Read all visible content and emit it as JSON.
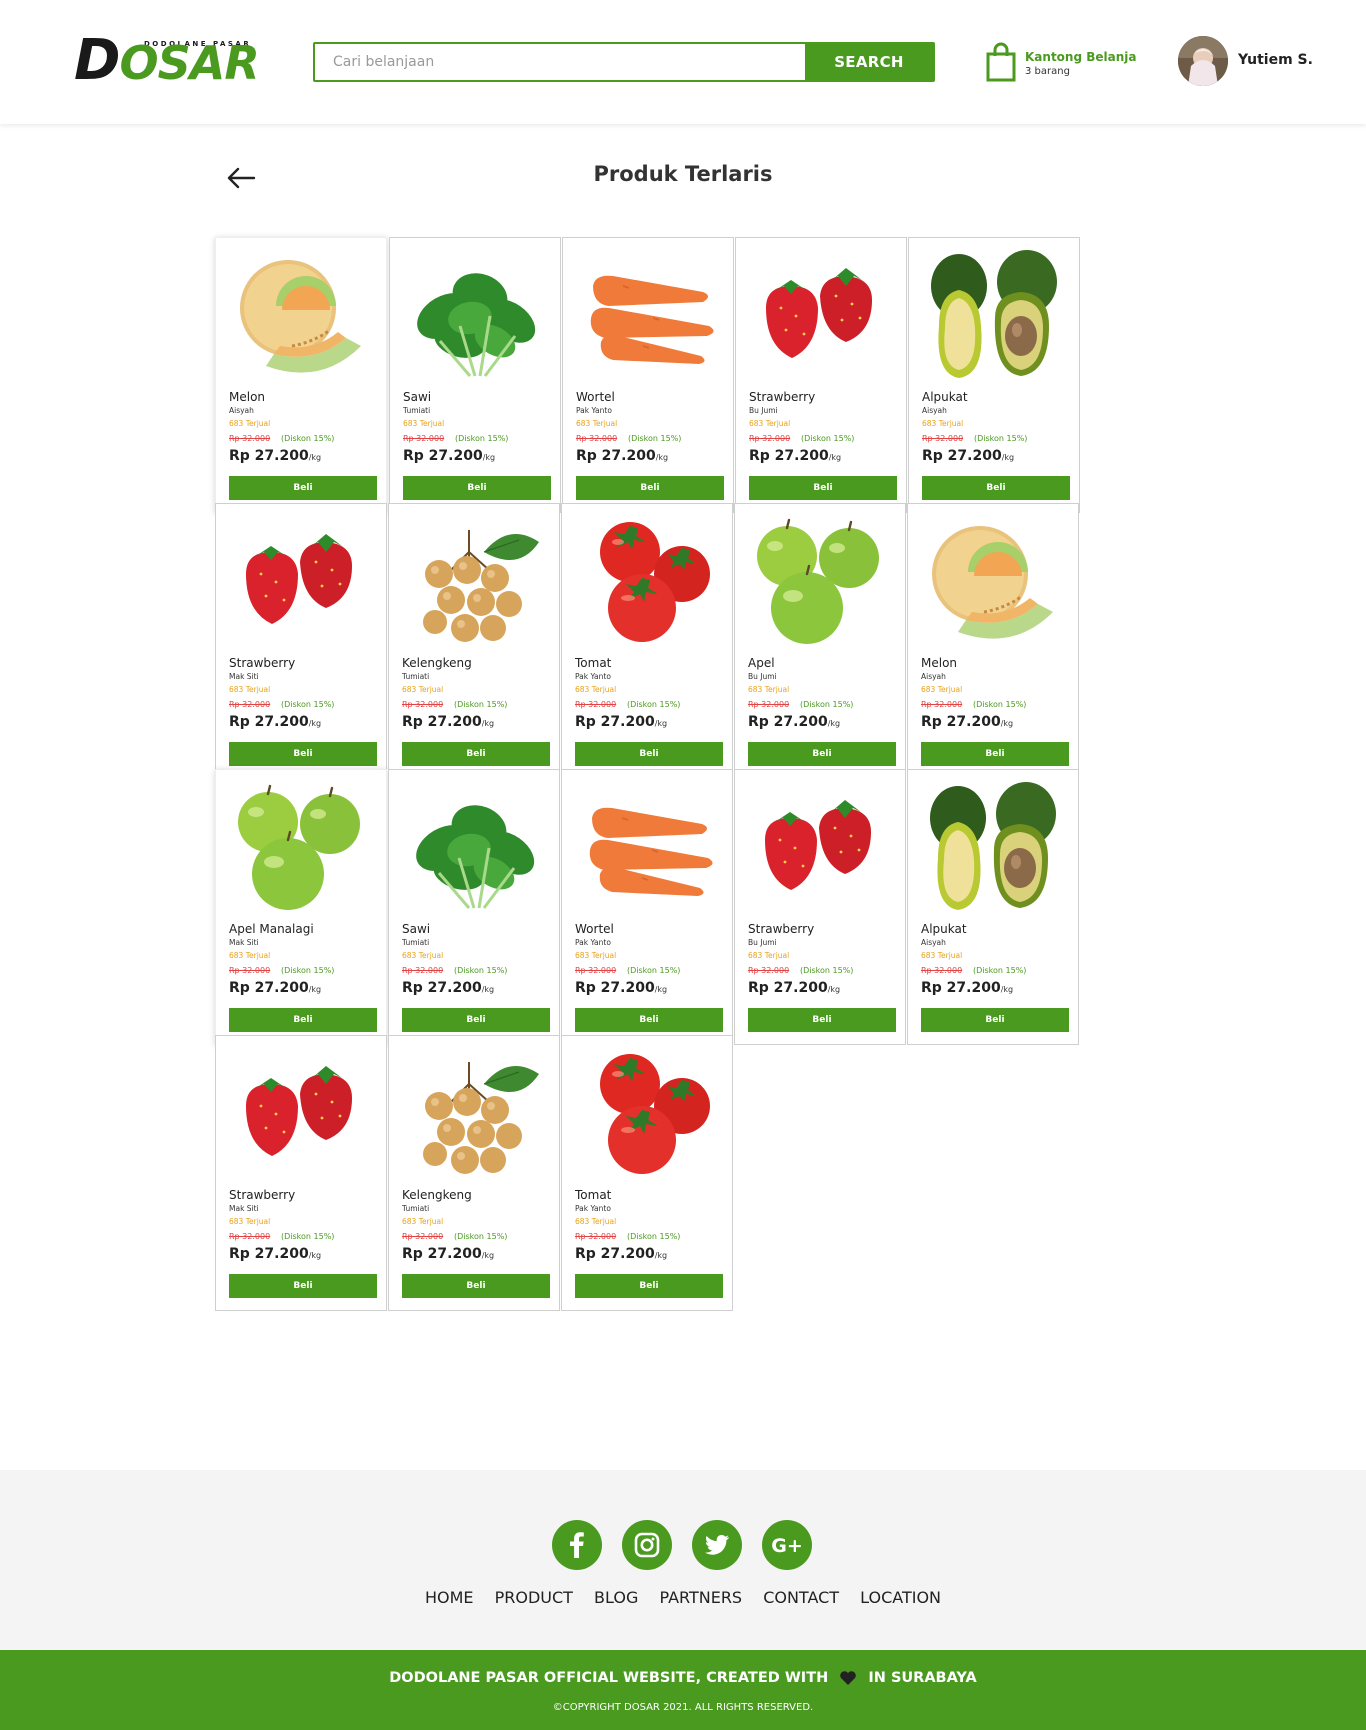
{
  "header": {
    "logo_tagline": "DODOLANE PASAR",
    "logo_d": "D",
    "logo_rest": "OSAR",
    "search_placeholder": "Cari belanjaan",
    "search_button": "SEARCH",
    "cart_title": "Kantong Belanja",
    "cart_count": "3 barang",
    "user_name": "Yutiem S."
  },
  "page": {
    "title": "Produk Terlaris"
  },
  "products": [
    {
      "name": "Melon",
      "seller": "Aisyah",
      "sold": "683 Terjual",
      "old_price": "Rp 32.000",
      "discount": "(Diskon 15%)",
      "price": "Rp 27.200",
      "unit": "/kg",
      "buy": "Beli",
      "image": "melon"
    },
    {
      "name": "Sawi",
      "seller": "Tumiati",
      "sold": "683 Terjual",
      "old_price": "Rp 32.000",
      "discount": "(Diskon 15%)",
      "price": "Rp 27.200",
      "unit": "/kg",
      "buy": "Beli",
      "image": "greens"
    },
    {
      "name": "Wortel",
      "seller": "Pak Yanto",
      "sold": "683 Terjual",
      "old_price": "Rp 32.000",
      "discount": "(Diskon 15%)",
      "price": "Rp 27.200",
      "unit": "/kg",
      "buy": "Beli",
      "image": "carrot"
    },
    {
      "name": "Strawberry",
      "seller": "Bu Jumi",
      "sold": "683 Terjual",
      "old_price": "Rp 32.000",
      "discount": "(Diskon 15%)",
      "price": "Rp 27.200",
      "unit": "/kg",
      "buy": "Beli",
      "image": "strawberry"
    },
    {
      "name": "Alpukat",
      "seller": "Aisyah",
      "sold": "683 Terjual",
      "old_price": "Rp 32.000",
      "discount": "(Diskon 15%)",
      "price": "Rp 27.200",
      "unit": "/kg",
      "buy": "Beli",
      "image": "avocado"
    },
    {
      "name": "Strawberry",
      "seller": "Mak Siti",
      "sold": "683 Terjual",
      "old_price": "Rp 32.000",
      "discount": "(Diskon 15%)",
      "price": "Rp 27.200",
      "unit": "/kg",
      "buy": "Beli",
      "image": "strawberry"
    },
    {
      "name": "Kelengkeng",
      "seller": "Tumiati",
      "sold": "683 Terjual",
      "old_price": "Rp 32.000",
      "discount": "(Diskon 15%)",
      "price": "Rp 27.200",
      "unit": "/kg",
      "buy": "Beli",
      "image": "longan"
    },
    {
      "name": "Tomat",
      "seller": "Pak Yanto",
      "sold": "683 Terjual",
      "old_price": "Rp 32.000",
      "discount": "(Diskon 15%)",
      "price": "Rp 27.200",
      "unit": "/kg",
      "buy": "Beli",
      "image": "tomato"
    },
    {
      "name": "Apel",
      "seller": "Bu Jumi",
      "sold": "683 Terjual",
      "old_price": "Rp 32.000",
      "discount": "(Diskon 15%)",
      "price": "Rp 27.200",
      "unit": "/kg",
      "buy": "Beli",
      "image": "apple"
    },
    {
      "name": "Melon",
      "seller": "Aisyah",
      "sold": "683 Terjual",
      "old_price": "Rp 32.000",
      "discount": "(Diskon 15%)",
      "price": "Rp 27.200",
      "unit": "/kg",
      "buy": "Beli",
      "image": "melon"
    },
    {
      "name": "Apel Manalagi",
      "seller": "Mak Siti",
      "sold": "683 Terjual",
      "old_price": "Rp 32.000",
      "discount": "(Diskon 15%)",
      "price": "Rp 27.200",
      "unit": "/kg",
      "buy": "Beli",
      "image": "apple"
    },
    {
      "name": "Sawi",
      "seller": "Tumiati",
      "sold": "683 Terjual",
      "old_price": "Rp 32.000",
      "discount": "(Diskon 15%)",
      "price": "Rp 27.200",
      "unit": "/kg",
      "buy": "Beli",
      "image": "greens"
    },
    {
      "name": "Wortel",
      "seller": "Pak Yanto",
      "sold": "683 Terjual",
      "old_price": "Rp 32.000",
      "discount": "(Diskon 15%)",
      "price": "Rp 27.200",
      "unit": "/kg",
      "buy": "Beli",
      "image": "carrot"
    },
    {
      "name": "Strawberry",
      "seller": "Bu Jumi",
      "sold": "683 Terjual",
      "old_price": "Rp 32.000",
      "discount": "(Diskon 15%)",
      "price": "Rp 27.200",
      "unit": "/kg",
      "buy": "Beli",
      "image": "strawberry"
    },
    {
      "name": "Alpukat",
      "seller": "Aisyah",
      "sold": "683 Terjual",
      "old_price": "Rp 32.000",
      "discount": "(Diskon 15%)",
      "price": "Rp 27.200",
      "unit": "/kg",
      "buy": "Beli",
      "image": "avocado"
    },
    {
      "name": "Strawberry",
      "seller": "Mak Siti",
      "sold": "683 Terjual",
      "old_price": "Rp 32.000",
      "discount": "(Diskon 15%)",
      "price": "Rp 27.200",
      "unit": "/kg",
      "buy": "Beli",
      "image": "strawberry"
    },
    {
      "name": "Kelengkeng",
      "seller": "Tumiati",
      "sold": "683 Terjual",
      "old_price": "Rp 32.000",
      "discount": "(Diskon 15%)",
      "price": "Rp 27.200",
      "unit": "/kg",
      "buy": "Beli",
      "image": "longan"
    },
    {
      "name": "Tomat",
      "seller": "Pak Yanto",
      "sold": "683 Terjual",
      "old_price": "Rp 32.000",
      "discount": "(Diskon 15%)",
      "price": "Rp 27.200",
      "unit": "/kg",
      "buy": "Beli",
      "image": "tomato"
    }
  ],
  "footer": {
    "socials": [
      "facebook-icon",
      "instagram-icon",
      "twitter-icon",
      "google-plus-icon"
    ],
    "nav": [
      "HOME",
      "PRODUCT",
      "BLOG",
      "PARTNERS",
      "CONTACT",
      "LOCATION"
    ],
    "line1_a": "DODOLANE PASAR OFFICIAL WEBSITE, CREATED WITH",
    "line1_b": "IN SURABAYA",
    "copyright": "©COPYRIGHT DOSAR 2021. ALL RIGHTS RESERVED."
  },
  "colors": {
    "brand_green": "#4a9a1f",
    "sold_orange": "#e8a21b",
    "old_price_red": "#e04444"
  }
}
